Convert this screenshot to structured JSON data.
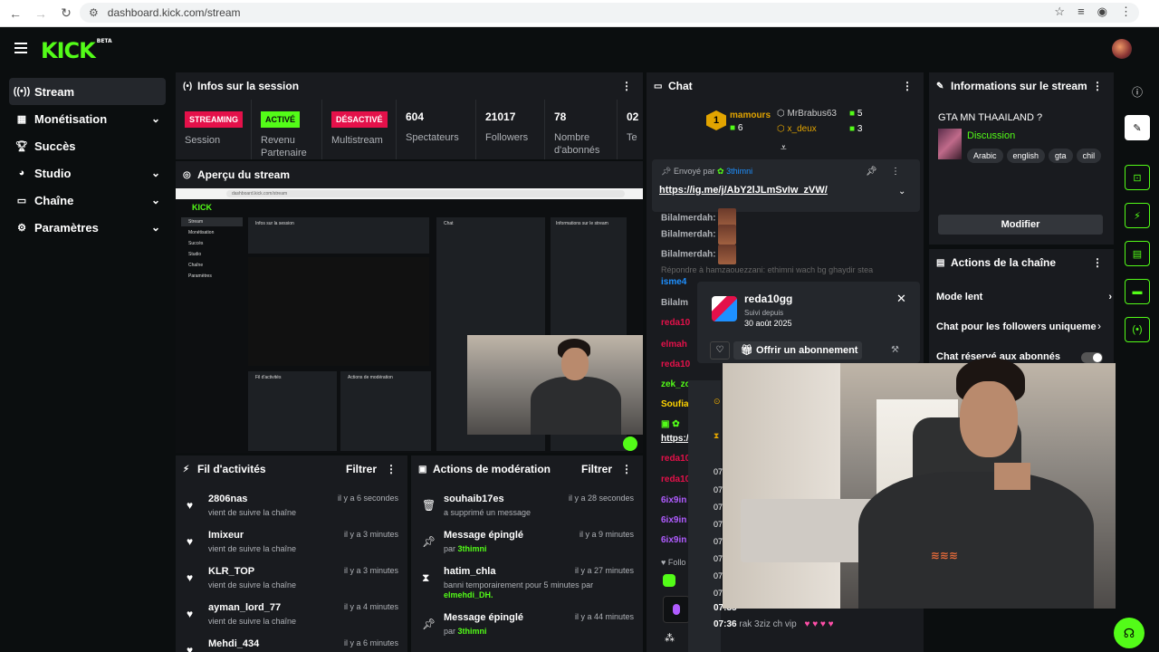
{
  "browser": {
    "url": "dashboard.kick.com/stream"
  },
  "brand": {
    "logo": "KICK",
    "beta": "BETA",
    "accent": "#53fc18"
  },
  "sidebar": {
    "items": [
      {
        "label": "Stream",
        "icon": "broadcast-icon",
        "active": true
      },
      {
        "label": "Monétisation",
        "icon": "chart-icon"
      },
      {
        "label": "Succès",
        "icon": "trophy-icon"
      },
      {
        "label": "Studio",
        "icon": "palette-icon"
      },
      {
        "label": "Chaîne",
        "icon": "channel-icon"
      },
      {
        "label": "Paramètres",
        "icon": "gear-icon"
      }
    ]
  },
  "session": {
    "title": "Infos sur la session",
    "stats": [
      {
        "badge": "STREAMING",
        "label": "Session"
      },
      {
        "badge": "ACTIVÉ",
        "label": "Revenu Partenaire"
      },
      {
        "badge": "DÉSACTIVÉ",
        "label": "Multistream"
      },
      {
        "value": "604",
        "label": "Spectateurs"
      },
      {
        "value": "21017",
        "label": "Followers"
      },
      {
        "value": "78",
        "label": "Nombre d'abonnés"
      },
      {
        "value": "02",
        "label": "Te"
      }
    ]
  },
  "preview": {
    "title": "Aperçu du stream"
  },
  "activity": {
    "title": "Fil d'activités",
    "filter": "Filtrer",
    "items": [
      {
        "name": "2806nas",
        "text": "vient de suivre la chaîne",
        "time": "il y a 6 secondes"
      },
      {
        "name": "Imixeur",
        "text": "vient de suivre la chaîne",
        "time": "il y a 3 minutes"
      },
      {
        "name": "KLR_TOP",
        "text": "vient de suivre la chaîne",
        "time": "il y a 3 minutes"
      },
      {
        "name": "ayman_lord_77",
        "text": "vient de suivre la chaîne",
        "time": "il y a 4 minutes"
      },
      {
        "name": "Mehdi_434",
        "text": "",
        "time": "il y a 6 minutes"
      }
    ]
  },
  "moderation": {
    "title": "Actions de modération",
    "filter": "Filtrer",
    "items": [
      {
        "name": "souhaib17es",
        "text": "a supprimé un message",
        "by": "",
        "time": "il y a 28 secondes"
      },
      {
        "name": "Message épinglé",
        "text": "par ",
        "by": "3thimni",
        "time": "il y a 9 minutes"
      },
      {
        "name": "hatim_chla",
        "text": "banni temporairement pour 5 minutes par",
        "by": "elmehdi_DH.",
        "time": "il y a 27 minutes"
      },
      {
        "name": "Message épinglé",
        "text": "par ",
        "by": "3thimni",
        "time": "il y a 44 minutes"
      }
    ]
  },
  "chat": {
    "title": "Chat",
    "top_gifters": [
      {
        "rank": "1",
        "name": "mamours",
        "count": "6"
      },
      {
        "name": "MrBrabus63",
        "count": "5"
      },
      {
        "name": "x_deux",
        "count": "3"
      }
    ],
    "pinned": {
      "label": "Envoyé par",
      "user": "3thimni",
      "link": "https://ig.me/j/AbY2lJLmSvIw_zVW/"
    },
    "lines": [
      {
        "user": "Bilalmerdah:",
        "color": "#aeb1b6"
      },
      {
        "user": "Bilalmerdah:",
        "color": "#aeb1b6"
      },
      {
        "user": "Bilalmerdah:",
        "color": "#aeb1b6"
      },
      {
        "reply": "Répondre à hamzaouezzani: ethimni wach bg ghaydir stea"
      },
      {
        "user": "isme4",
        "color": "#1e90ff"
      },
      {
        "user": "Bilalm",
        "color": "#aeb1b6"
      },
      {
        "user": "reda10",
        "color": "#e4114a"
      },
      {
        "user": "elmah",
        "color": "#e4114a"
      },
      {
        "user": "reda10",
        "color": "#e4114a"
      },
      {
        "user": "zek_zo",
        "color": "#53fc18"
      },
      {
        "user": "Soufia",
        "color": "#ffd400"
      },
      {
        "user": "https:/",
        "color": "#fff"
      },
      {
        "user": "reda10",
        "color": "#e4114a"
      },
      {
        "user": "reda10",
        "color": "#e4114a"
      },
      {
        "user": "6ix9in",
        "color": "#b05cff"
      },
      {
        "user": "6ix9in",
        "color": "#b05cff"
      },
      {
        "user": "6ix9in",
        "color": "#b05cff"
      }
    ],
    "follow_label": "Follo",
    "times": [
      "07:",
      "07:",
      "07:",
      "07:",
      "07:",
      "07:",
      "07:",
      "07:",
      "07:35"
    ],
    "last_msg": {
      "time": "07:36",
      "text": "rak 3ziz ch vip"
    },
    "hearts": "♥ ♥ ♥ ♥"
  },
  "user_card": {
    "name": "reda10gg",
    "since_label": "Suivi depuis",
    "since_date": "30 août 2025",
    "sub_button": "Offrir un abonnement"
  },
  "stream_info": {
    "title": "Informations sur le stream",
    "stream_title": "GTA MN THAAILAND ?",
    "category": "Discussion",
    "tags": [
      "Arabic",
      "english",
      "gta",
      "chil"
    ],
    "edit_button": "Modifier"
  },
  "channel_actions": {
    "title": "Actions de la chaîne",
    "items": [
      {
        "label": "Mode lent"
      },
      {
        "label": "Chat pour les followers uniqueme"
      },
      {
        "label": "Chat réservé aux abonnés"
      }
    ]
  }
}
